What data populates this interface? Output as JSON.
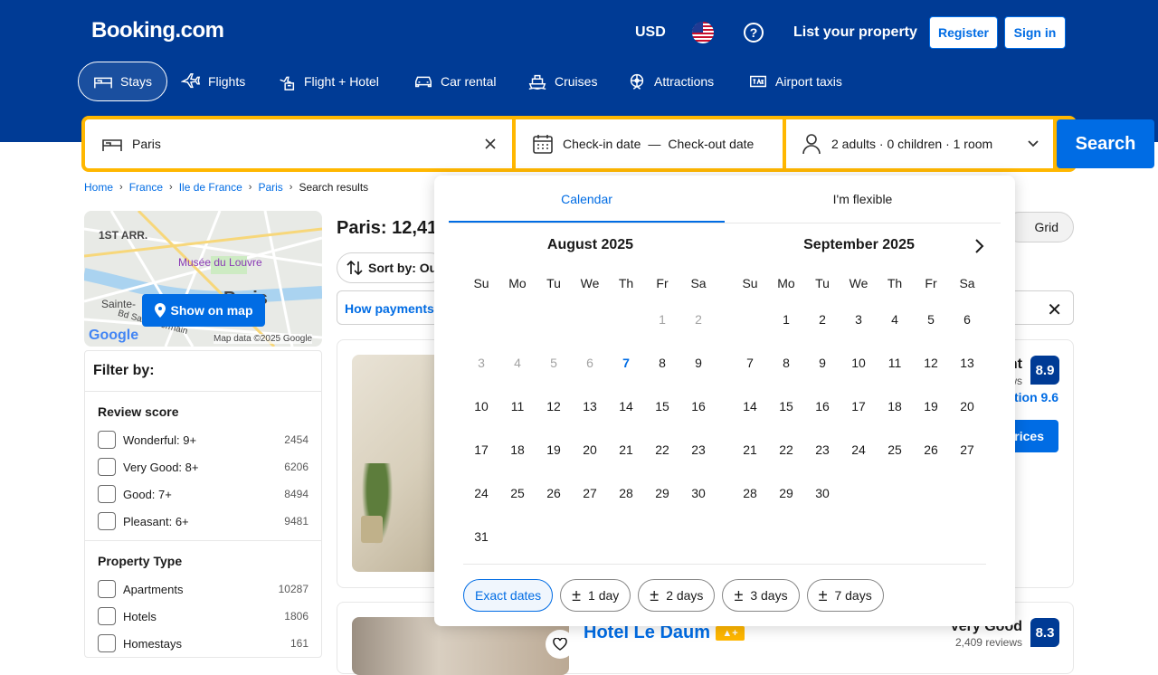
{
  "header": {
    "logo": "Booking.com",
    "currency": "USD",
    "list_property": "List your property",
    "register": "Register",
    "signin": "Sign in",
    "help_glyph": "?"
  },
  "nav": [
    {
      "label": "Stays",
      "icon": "bed-icon"
    },
    {
      "label": "Flights",
      "icon": "plane-icon"
    },
    {
      "label": "Flight + Hotel",
      "icon": "flight-hotel-icon"
    },
    {
      "label": "Car rental",
      "icon": "car-icon"
    },
    {
      "label": "Cruises",
      "icon": "ship-icon"
    },
    {
      "label": "Attractions",
      "icon": "attractions-icon"
    },
    {
      "label": "Airport taxis",
      "icon": "taxi-icon"
    }
  ],
  "search": {
    "destination": "Paris",
    "checkin": "Check-in date",
    "dash": "—",
    "checkout": "Check-out date",
    "guests": "2 adults · 0 children · 1 room",
    "button": "Search"
  },
  "breadcrumb": [
    "Home",
    "France",
    "Ile de France",
    "Paris",
    "Search results"
  ],
  "map": {
    "show_on_map": "Show on map",
    "labels": [
      "1ST ARR.",
      "Musée du Louvre",
      "Sainte-",
      "Bd Saint-Germain",
      "Paris",
      "Google",
      "Map data ©2025 Google"
    ]
  },
  "filters": {
    "title": "Filter by:",
    "groups": [
      {
        "title": "Review score",
        "items": [
          {
            "label": "Wonderful: 9+",
            "count": "2454"
          },
          {
            "label": "Very Good: 8+",
            "count": "6206"
          },
          {
            "label": "Good: 7+",
            "count": "8494"
          },
          {
            "label": "Pleasant: 6+",
            "count": "9481"
          }
        ]
      },
      {
        "title": "Property Type",
        "items": [
          {
            "label": "Apartments",
            "count": "10287"
          },
          {
            "label": "Hotels",
            "count": "1806"
          },
          {
            "label": "Homestays",
            "count": "161"
          }
        ]
      }
    ]
  },
  "results": {
    "title": "Paris: 12,41",
    "sort": "Sort by: Ou",
    "payments": "How payments",
    "grid": "Grid",
    "close_glyph": "✕"
  },
  "hotels": [
    {
      "name": "",
      "score_text": "nt",
      "reviews": "ws",
      "location_score": "tion 9.6",
      "score": "8.9",
      "button": "prices"
    },
    {
      "name": "Hotel Le Daum",
      "score_text": "Very Good",
      "reviews": "2,409 reviews",
      "score": "8.3"
    }
  ],
  "calendar": {
    "tabs": [
      "Calendar",
      "I'm flexible"
    ],
    "weekdays": [
      "Su",
      "Mo",
      "Tu",
      "We",
      "Th",
      "Fr",
      "Sa"
    ],
    "months": [
      {
        "title": "August 2025",
        "offset": 5,
        "days": 31,
        "past_until": 6,
        "today": 7
      },
      {
        "title": "September 2025",
        "offset": 1,
        "days": 30,
        "past_until": 0,
        "today": 0
      }
    ],
    "chips": [
      "Exact dates",
      "1 day",
      "2 days",
      "3 days",
      "7 days"
    ],
    "active_chip": 0
  },
  "colors": {
    "brand_blue": "#003b95",
    "action_blue": "#006ce4",
    "accent_yellow": "#ffb700"
  }
}
